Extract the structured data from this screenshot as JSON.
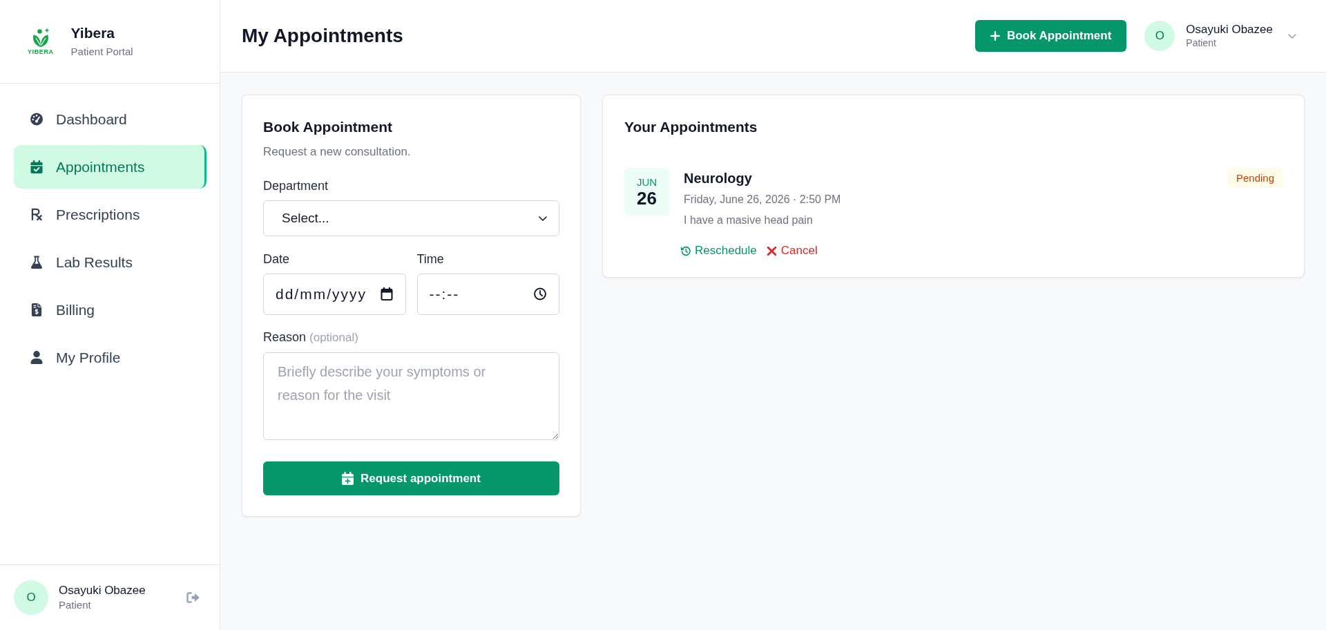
{
  "sidebar": {
    "logo": {
      "wordmark": "YIBERA"
    },
    "brand": {
      "name": "Yibera",
      "tagline": "Patient Portal"
    },
    "nav_items": [
      {
        "label": "Dashboard",
        "selected": false
      },
      {
        "label": "Appointments",
        "selected": true
      },
      {
        "label": "Prescriptions",
        "selected": false
      },
      {
        "label": "Lab Results",
        "selected": false
      },
      {
        "label": "Billing",
        "selected": false
      },
      {
        "label": "My Profile",
        "selected": false
      }
    ],
    "user": {
      "initial": "O",
      "name": "Osayuki Obazee",
      "role": "Patient"
    }
  },
  "header": {
    "title": "My Appointments",
    "action_button": "Book Appointment",
    "user": {
      "initial": "O",
      "name": "Osayuki Obazee",
      "role": "Patient"
    }
  },
  "booking_form": {
    "title": "Book Appointment",
    "subtitle": "Request a new consultation.",
    "department": {
      "label": "Department",
      "value": "Select..."
    },
    "date": {
      "label": "Date",
      "placeholder": "dd/mm/yyyy"
    },
    "time": {
      "label": "Time",
      "placeholder": "--:--"
    },
    "reason": {
      "label": "Reason",
      "hint": "(optional)",
      "placeholder": "Briefly describe your symptoms or reason for the visit"
    },
    "submit_button": "Request appointment"
  },
  "appointments": {
    "title": "Your Appointments",
    "items": [
      {
        "month": "JUN",
        "day": "26",
        "department": "Neurology",
        "datetime": "Friday, June 26, 2026 · 2:50 PM",
        "note": "I have a masive head pain",
        "status": {
          "kind": "pending",
          "label": "Pending"
        },
        "actions": [
          {
            "kind": "reschedule",
            "label": "Reschedule"
          },
          {
            "kind": "cancel",
            "label": "Cancel"
          }
        ]
      }
    ]
  }
}
